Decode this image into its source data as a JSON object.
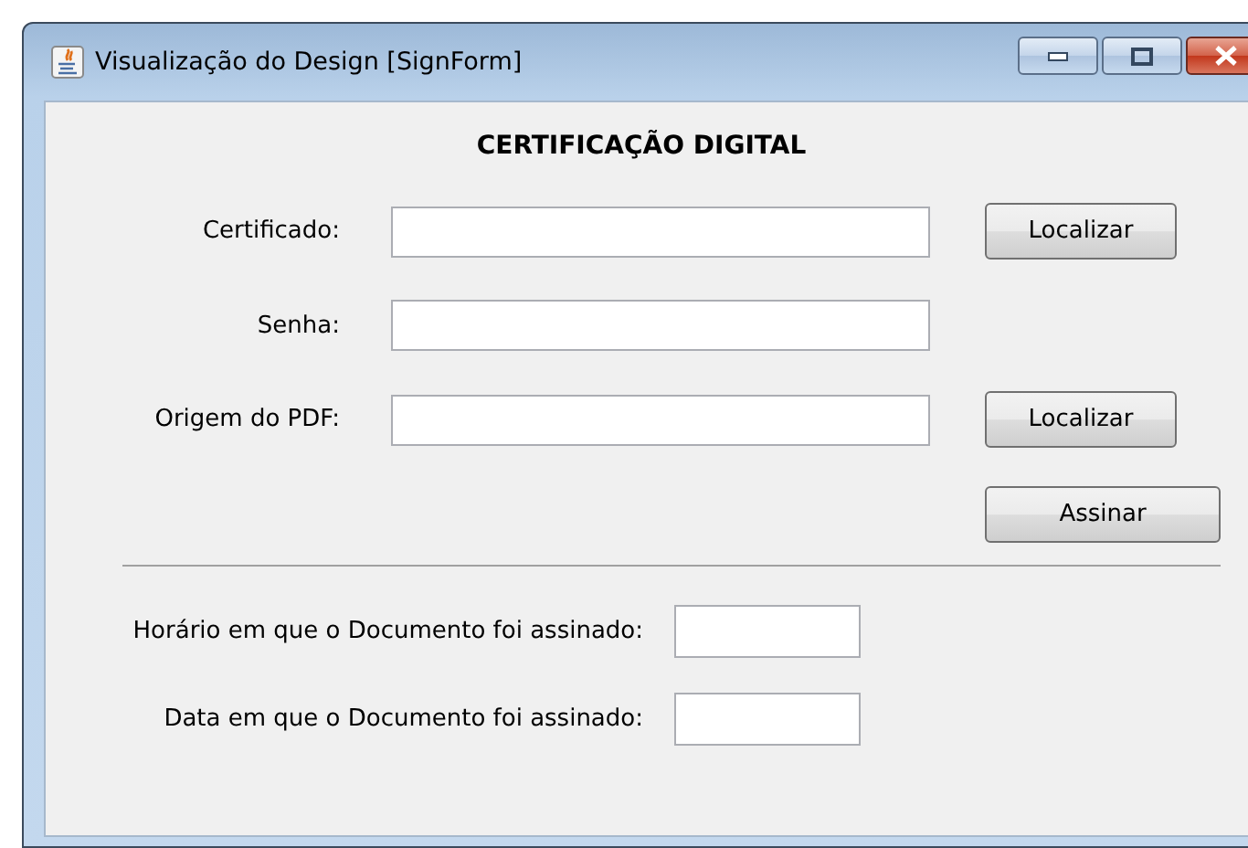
{
  "window": {
    "title": "Visualização do Design [SignForm]"
  },
  "heading": "CERTIFICAÇÃO DIGITAL",
  "fields": [
    {
      "label": "Certificado:",
      "button": "Localizar"
    },
    {
      "label": "Senha:"
    },
    {
      "label": "Origem do PDF:",
      "button": "Localizar"
    }
  ],
  "action_button": "Assinar",
  "result_fields": [
    {
      "label": "Horário em que o Documento foi assinado:"
    },
    {
      "label": "Data em que o Documento foi assinado:"
    }
  ]
}
